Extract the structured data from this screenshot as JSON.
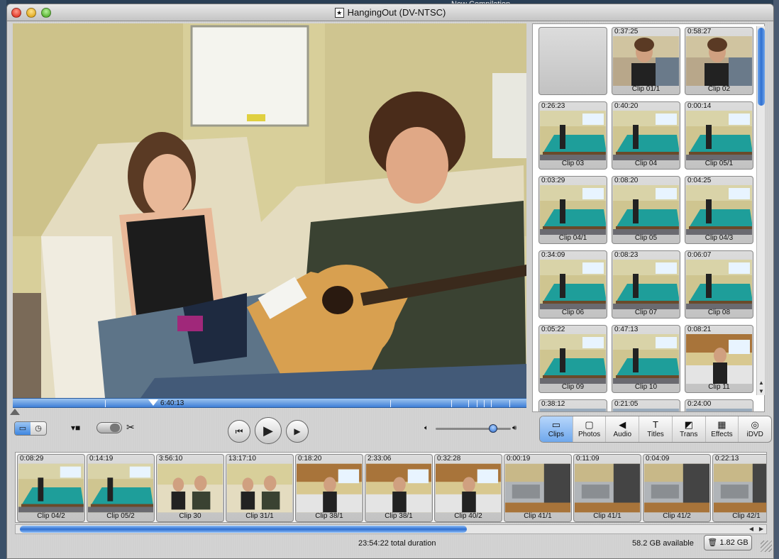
{
  "background": {
    "other_window_title": "New Compilation"
  },
  "window": {
    "title": "HangingOut (DV-NTSC)",
    "title_icon": "★"
  },
  "viewer": {
    "playhead_time": "6:40:13",
    "playhead_position": 0.274
  },
  "shelf": {
    "clips": [
      {
        "time": "",
        "name": "",
        "scene": "empty"
      },
      {
        "time": "0:37:25",
        "name": "Clip 01/1",
        "scene": "person"
      },
      {
        "time": "0:58:27",
        "name": "Clip 02",
        "scene": "person"
      },
      {
        "time": "0:26:23",
        "name": "Clip 03",
        "scene": "pool"
      },
      {
        "time": "0:40:20",
        "name": "Clip 04",
        "scene": "pool"
      },
      {
        "time": "0:00:14",
        "name": "Clip 05/1",
        "scene": "pool"
      },
      {
        "time": "0:03:29",
        "name": "Clip 04/1",
        "scene": "pool"
      },
      {
        "time": "0:08:20",
        "name": "Clip 05",
        "scene": "pool"
      },
      {
        "time": "0:04:25",
        "name": "Clip 04/3",
        "scene": "pool"
      },
      {
        "time": "0:34:09",
        "name": "Clip 06",
        "scene": "pool"
      },
      {
        "time": "0:08:23",
        "name": "Clip 07",
        "scene": "pool"
      },
      {
        "time": "0:06:07",
        "name": "Clip 08",
        "scene": "pool"
      },
      {
        "time": "0:05:22",
        "name": "Clip 09",
        "scene": "pool"
      },
      {
        "time": "0:47:13",
        "name": "Clip 10",
        "scene": "pool"
      },
      {
        "time": "0:08:21",
        "name": "Clip 11",
        "scene": "kitchen"
      },
      {
        "time": "0:38:12",
        "name": "",
        "scene": "partial"
      },
      {
        "time": "0:21:05",
        "name": "",
        "scene": "partial"
      },
      {
        "time": "0:24:00",
        "name": "",
        "scene": "partial"
      }
    ]
  },
  "controls": {
    "panels": [
      {
        "label": "Clips",
        "icon": "clips-icon",
        "glyph": "▭",
        "active": true
      },
      {
        "label": "Photos",
        "icon": "photos-icon",
        "glyph": "▢",
        "active": false
      },
      {
        "label": "Audio",
        "icon": "audio-icon",
        "glyph": "◀",
        "active": false
      },
      {
        "label": "Titles",
        "icon": "titles-icon",
        "glyph": "T",
        "active": false
      },
      {
        "label": "Trans",
        "icon": "transitions-icon",
        "glyph": "◩",
        "active": false
      },
      {
        "label": "Effects",
        "icon": "effects-icon",
        "glyph": "▦",
        "active": false
      },
      {
        "label": "iDVD",
        "icon": "idvd-icon",
        "glyph": "◎",
        "active": false
      }
    ],
    "volume_level": 0.76
  },
  "timeline": {
    "clips": [
      {
        "time": "0:08:29",
        "name": "Clip 04/2",
        "scene": "pool"
      },
      {
        "time": "0:14:19",
        "name": "Clip 05/2",
        "scene": "pool"
      },
      {
        "time": "3:56:10",
        "name": "Clip 30",
        "scene": "couch"
      },
      {
        "time": "13:17:10",
        "name": "Clip 31/1",
        "scene": "couch"
      },
      {
        "time": "0:18:20",
        "name": "Clip 38/1",
        "scene": "kitchen"
      },
      {
        "time": "2:33:06",
        "name": "Clip 38/1",
        "scene": "kitchen"
      },
      {
        "time": "0:32:28",
        "name": "Clip 40/2",
        "scene": "kitchen"
      },
      {
        "time": "0:00:19",
        "name": "Clip 41/1",
        "scene": "sink"
      },
      {
        "time": "0:11:09",
        "name": "Clip 41/1",
        "scene": "sink"
      },
      {
        "time": "0:04:09",
        "name": "Clip 41/2",
        "scene": "sink"
      },
      {
        "time": "0:22:13",
        "name": "Clip 42/1",
        "scene": "sink"
      }
    ]
  },
  "status": {
    "total_duration": "23:54:22 total duration",
    "available": "58.2 GB available",
    "trash_size": "1.82 GB"
  },
  "colors": {
    "accent": "#3e86e0",
    "pool": "#1e9e9a",
    "wall": "#d8cf9a"
  }
}
